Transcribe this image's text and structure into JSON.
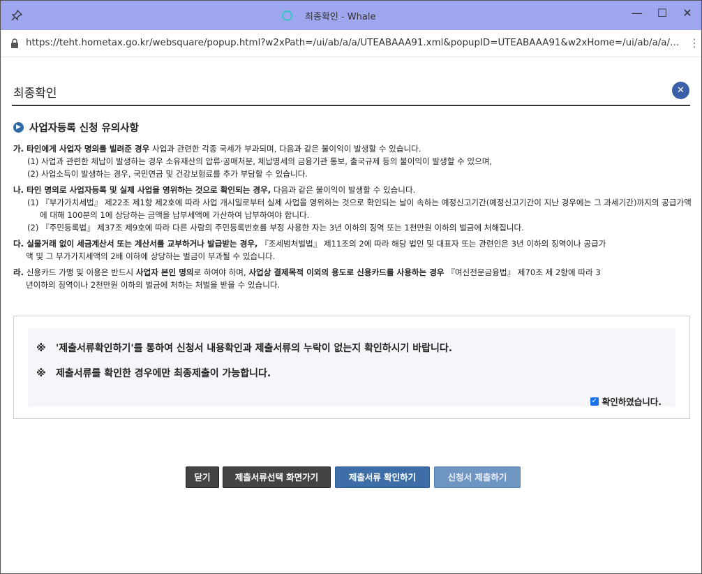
{
  "window": {
    "title": "최종확인 - Whale",
    "controls": {
      "minimize": "—",
      "maximize": "☐",
      "close": "✕"
    }
  },
  "addressbar": {
    "url": "https://teht.hometax.go.kr/websquare/popup.html?w2xPath=/ui/ab/a/a/UTEABAAA91.xml&popupID=UTEABAAA91&w2xHome=/ui/ab/a/a/&w2xDocu",
    "menu": "⋮"
  },
  "page": {
    "title": "최종확인",
    "close_label": "✕"
  },
  "section": {
    "title": "사업자등록 신청 유의사항"
  },
  "notices": {
    "ga": {
      "prefix": "가.",
      "bold": " 타인에게 사업자 명의를 빌려준 경우",
      "rest": " 사업과 관련한 각종 국세가 부과되며, 다음과 같은 불이익이 발생할 수 있습니다.",
      "items": [
        "(1) 사업과 관련한 체납이 발생하는 경우 소유재산의 압류·공매처분, 체납명세의 금융기관 통보, 출국규제 등의 불이익이 발생할 수 있으며,",
        "(2) 사업소득이 발생하는 경우, 국민연금 및 건강보험료를 추가 부담할 수 있습니다."
      ]
    },
    "na": {
      "prefix": "나.",
      "bold": " 타인 명의로 사업자등록 및 실제 사업을 영위하는 것으로 확인되는 경우,",
      "rest": " 다음과 같은 불이익이 발생할 수 있습니다.",
      "items": [
        "(1) 『부가가치세법』 제22조 제1항 제2호에 따라 사업 개시일로부터 실제 사업을 영위하는 것으로 확인되는 날이 속하는 예정신고기간(예정신고기간이 지난 경우에는 그 과세기간)까지의 공급가액에 대해 100분의 1에 상당하는 금액을 납부세액에 가산하여 납부하여야 합니다.",
        "(2) 『주민등록법』 제37조 제9호에 따라 다른 사람의 주민등록번호를 부정 사용한 자는 3년 이하의 징역 또는 1천만원 이하의 벌금에 처해집니다."
      ]
    },
    "da": {
      "prefix": "다.",
      "bold": " 실물거래 없이 세금계산서 또는 계산서를 교부하거나 발급받는 경우,",
      "rest": " 『조세범처벌법』 제11조의 2에 따라 해당 법인 및 대표자 또는 관련인은 3년 이하의 징역이나 공급가",
      "cont": "액 및 그 부가가치세액의 2배 이하에 상당하는 벌금이 부과될 수 있습니다."
    },
    "ra": {
      "prefix": "라.",
      "t1": " 신용카드 가맹 및 이용은 반드시 ",
      "b1": "사업자 본인 명의",
      "t2": "로 하여야 하며, ",
      "b2": "사업상 결제목적 이외의 용도로 신용카드를 사용하는 경우",
      "t3": " 『여신전문금융법』 제70조 제 2항에 따라 3",
      "cont": "년이하의 징역이나 2천만원 이하의 벌금에 처하는 처벌을 받을 수 있습니다."
    }
  },
  "confirm": {
    "mark": "※",
    "line1": "'제출서류확인하기'를 통하여 신청서 내용확인과 제출서류의 누락이 없는지 확인하시기 바랍니다.",
    "line2": "제출서류를 확인한 경우에만 최종제출이 가능합니다.",
    "checkbox_label": "확인하였습니다.",
    "checked": true
  },
  "buttons": {
    "close": "닫기",
    "goto_docs": "제출서류선택 화면가기",
    "confirm_docs": "제출서류 확인하기",
    "submit": "신청서 제출하기"
  },
  "colors": {
    "titlebar": "#9fa6f0",
    "accent": "#3a5fa8",
    "button_dark": "#444444",
    "button_blue": "#3d6ea8"
  }
}
